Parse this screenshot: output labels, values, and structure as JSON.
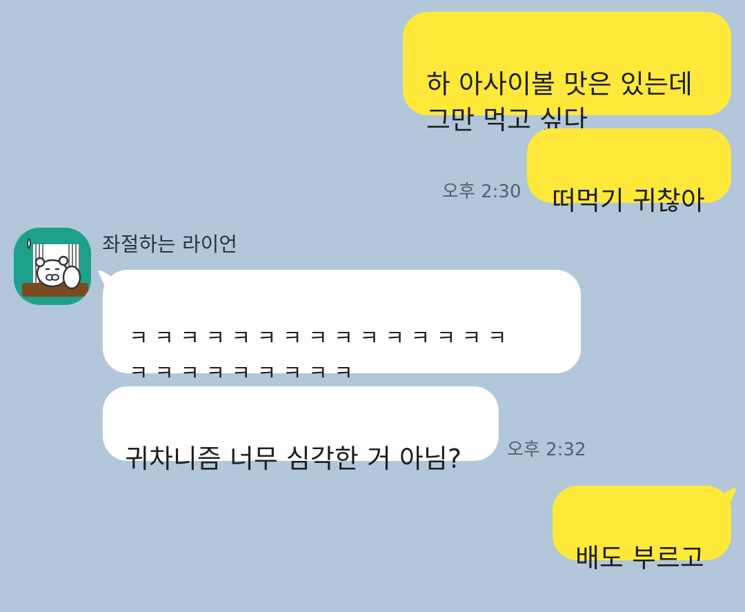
{
  "colors": {
    "background": "#b2c7da",
    "my_bubble": "#fee93b",
    "their_bubble": "#ffffff",
    "timestamp": "#55606b",
    "avatar_bg": "#1ea18a"
  },
  "messages": {
    "m1": {
      "text": "하 아사이볼 맛은 있는데\n그만 먹고 싶다"
    },
    "m2": {
      "text": "떠먹기 귀찮아",
      "time": "오후 2:30"
    },
    "m3": {
      "text": "ㅋ ㅋ ㅋ ㅋ ㅋ ㅋ ㅋ ㅋ ㅋ ㅋ ㅋ ㅋ ㅋ ㅋ ㅋ\nㅋ ㅋ ㅋ ㅋ ㅋ ㅋ ㅋ ㅋ ㅋ"
    },
    "m4": {
      "text": "귀차니즘 너무 심각한 거 아님?",
      "time": "오후 2:32"
    },
    "m5": {
      "text": "배도 부르고"
    }
  },
  "friend": {
    "name": "좌절하는 라이언",
    "avatar_icon": "frustrated-lion-avatar-icon"
  }
}
